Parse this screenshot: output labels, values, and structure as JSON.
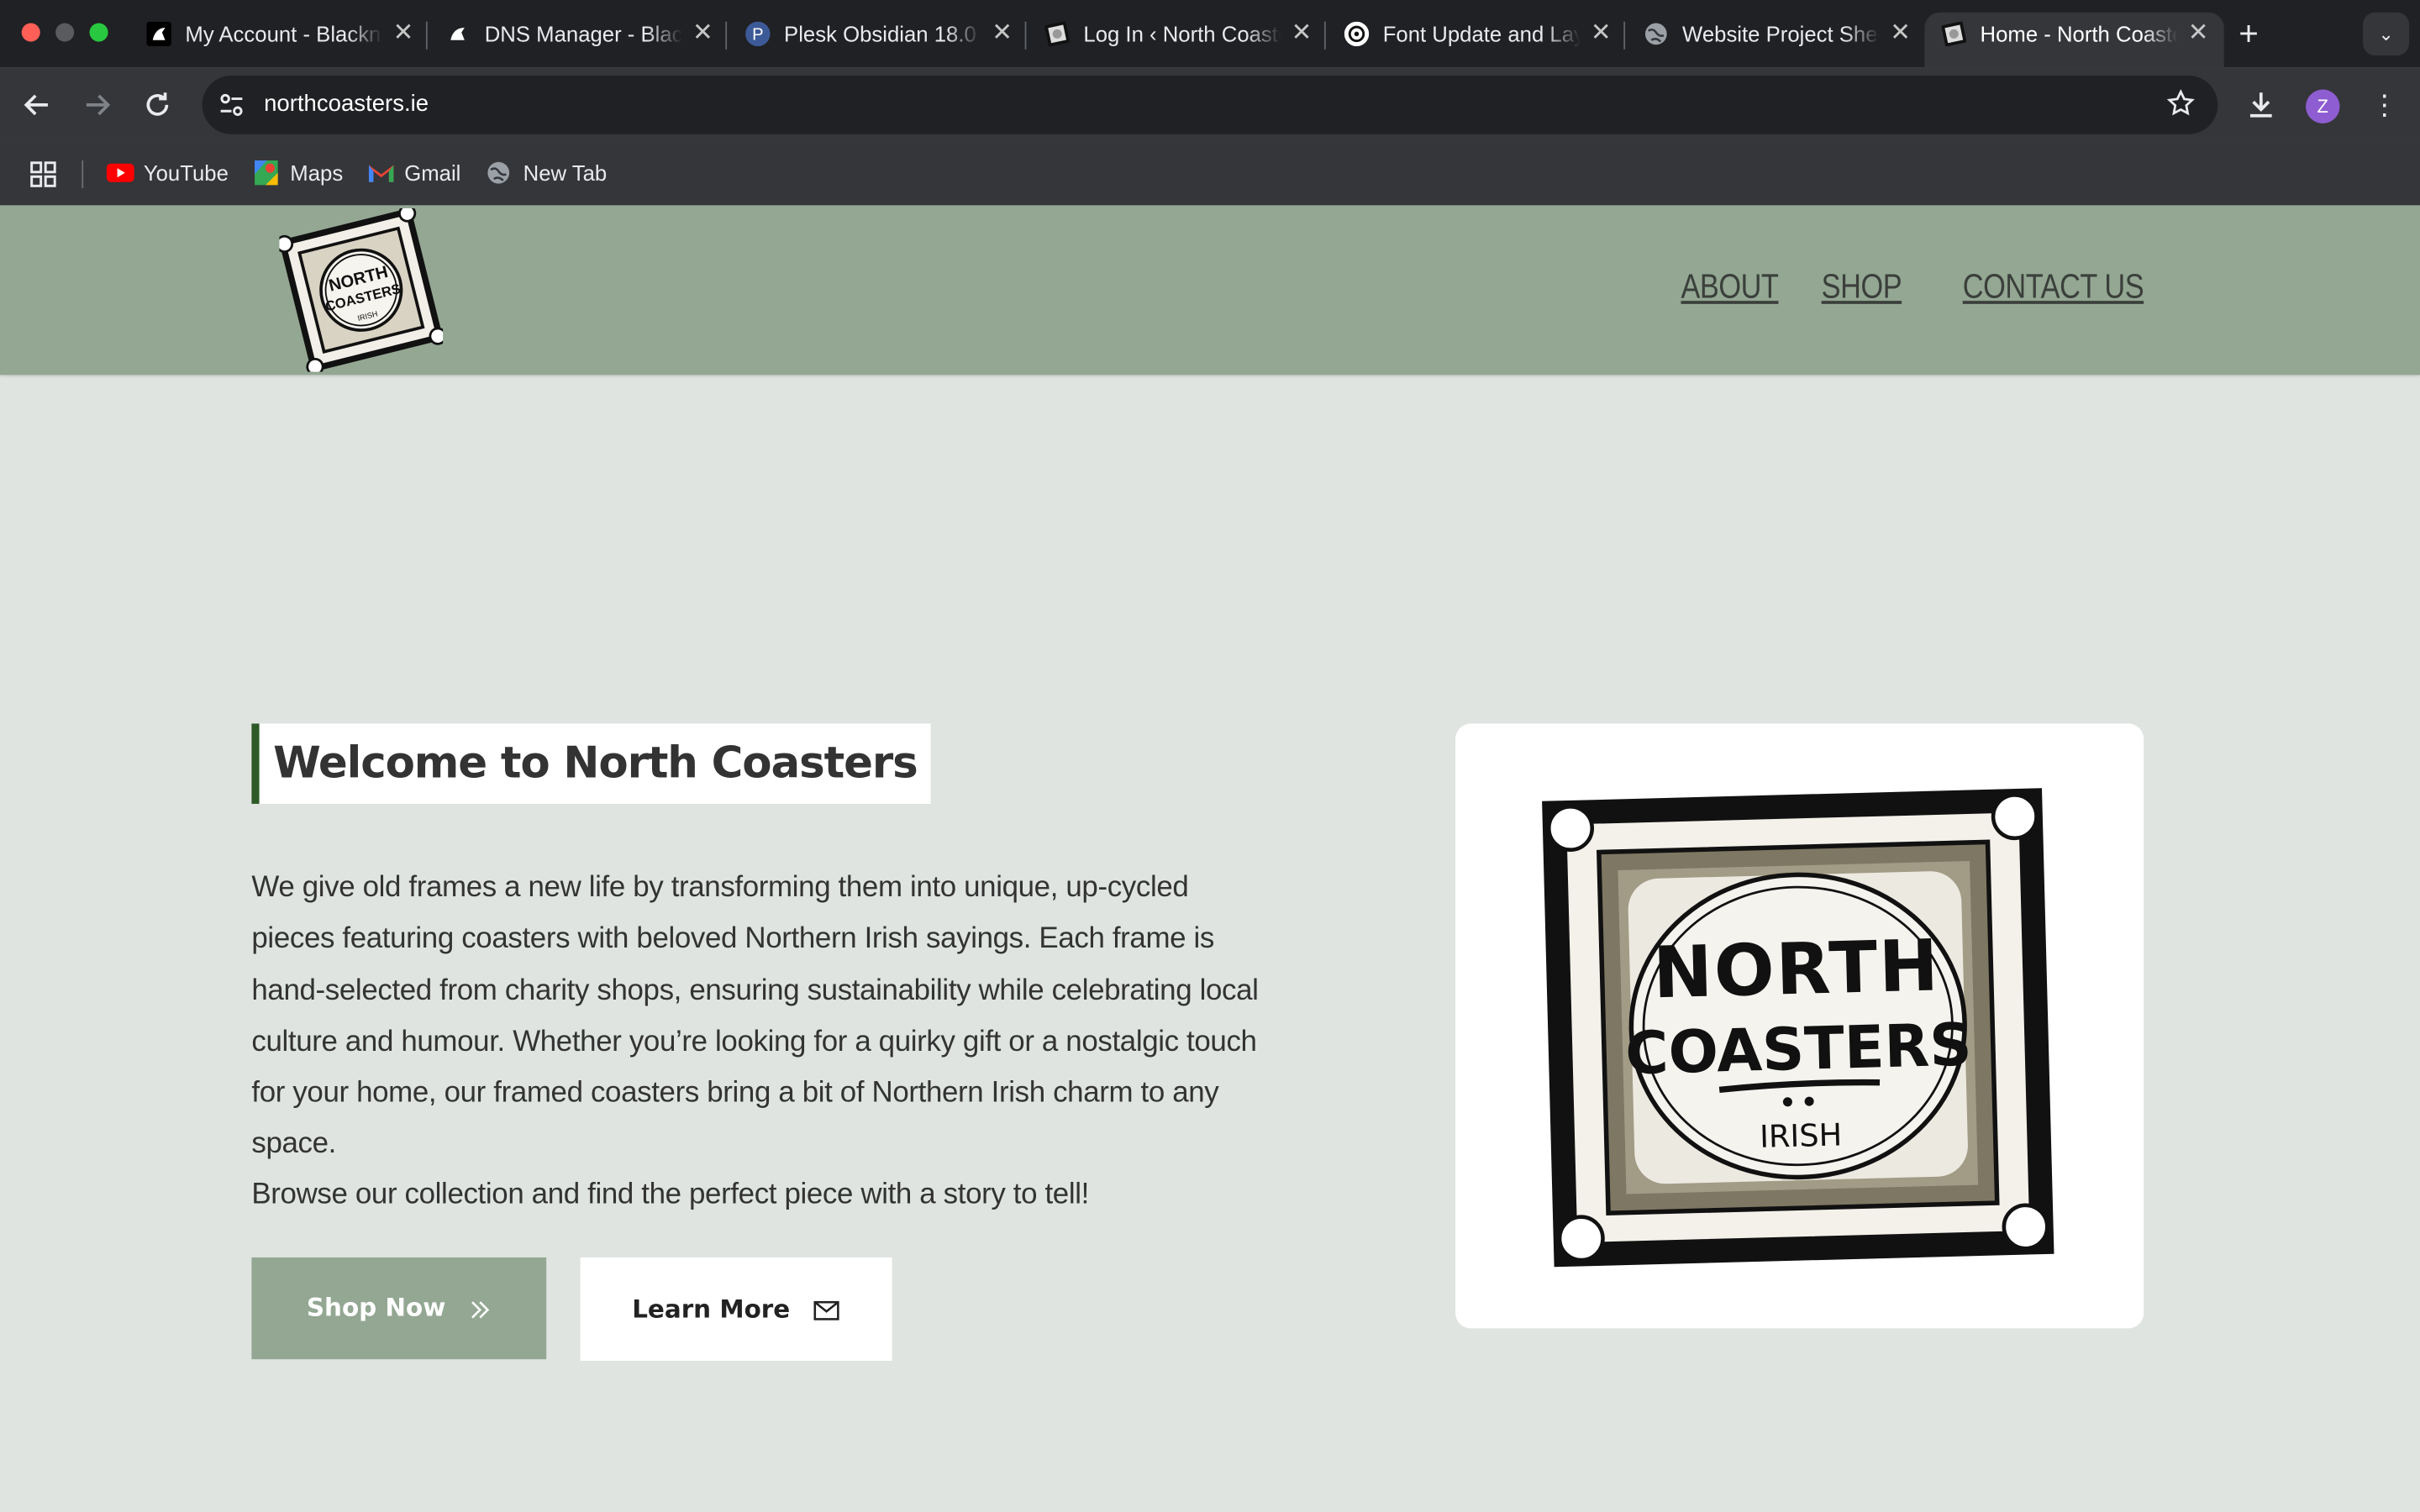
{
  "browser": {
    "tabs": [
      {
        "title": "My Account - Blacknight",
        "icon": "blacknight-icon",
        "active": false
      },
      {
        "title": "DNS Manager - Blacknight",
        "icon": "blacknight-icon",
        "active": false
      },
      {
        "title": "Plesk Obsidian 18.0",
        "icon": "plesk-icon",
        "active": false
      },
      {
        "title": "Log In ‹ North Coasters",
        "icon": "site-favicon",
        "active": false
      },
      {
        "title": "Font Update and Layout",
        "icon": "openai-icon",
        "active": false
      },
      {
        "title": "Website Project Sheet",
        "icon": "globe-icon",
        "active": false
      },
      {
        "title": "Home - North Coasters",
        "icon": "site-favicon",
        "active": true
      }
    ],
    "address": "northcoasters.ie",
    "profile_initial": "Z",
    "bookmarks": [
      {
        "label": "YouTube",
        "icon": "youtube-icon"
      },
      {
        "label": "Maps",
        "icon": "maps-icon"
      },
      {
        "label": "Gmail",
        "icon": "gmail-icon"
      },
      {
        "label": "New Tab",
        "icon": "globe-icon"
      }
    ]
  },
  "site": {
    "logo_alt": "North Coasters Irish logo",
    "nav": [
      {
        "label": "ABOUT"
      },
      {
        "label": "SHOP"
      },
      {
        "label": "CONTACT US"
      }
    ],
    "hero": {
      "title": "Welcome to North Coasters",
      "intro": "We give old frames a new life by transforming them into unique, up-cycled pieces featuring coasters with beloved Northern Irish sayings. Each frame is hand-selected from charity shops, ensuring sustainability while celebrating local culture and humour. Whether you’re looking for a quirky gift or a nostalgic touch for your home, our framed coasters bring a bit of Northern Irish charm to any space.",
      "browse": "Browse our collection and find the perfect piece with a story to tell!",
      "shop_button": "Shop Now",
      "learn_button": "Learn More"
    },
    "logo_text": {
      "line1": "NORTH",
      "line2": "COASTERS",
      "line3": "IRISH"
    }
  },
  "colors": {
    "header_green": "#93a793",
    "page_bg": "#dfe4e0",
    "accent_dark_green": "#2d5a27",
    "text": "#333333"
  }
}
